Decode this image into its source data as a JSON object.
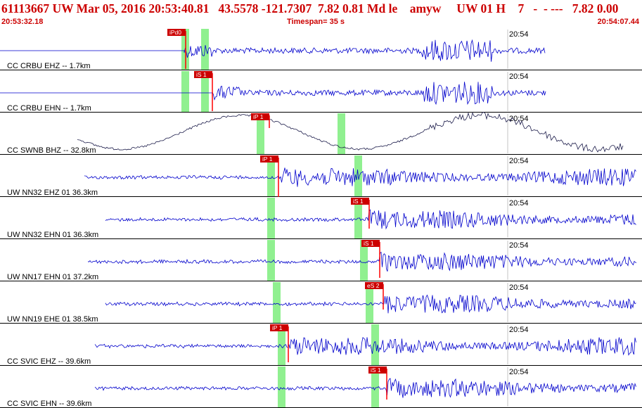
{
  "header": {
    "title": "61113667 UW Mar 05, 2016 20:53:40.81   43.5578 -121.7307  7.82 0.81 Md le    amyw     UW 01 H    7   -  - ---   7.82 0.00",
    "start_time": "20:53:32.18",
    "timespan": "Timespan=  35 s",
    "end_time": "20:54:07.44"
  },
  "time_marker_label": "20:54",
  "colors": {
    "header_text": "#cc0000",
    "trace_blue": "#0000cc",
    "trace_dark": "#1c1c4a",
    "pick_bar": "#ff0000",
    "window_band": "#90f090",
    "separator": "#000000"
  },
  "channels": [
    {
      "label": "CC CRBU EHZ -- 1.7km",
      "style": "blue",
      "pick": "iPd0",
      "amp": 1.0
    },
    {
      "label": "CC CRBU EHN -- 1.7km",
      "style": "blue",
      "pick": "iS 1",
      "amp": 0.9
    },
    {
      "label": "CC SWNB BHZ -- 32.8km",
      "style": "dark",
      "pick": "iP 1",
      "amp": 1.0
    },
    {
      "label": "UW NN32 EHZ 01 36.3km",
      "style": "blue",
      "pick": "iP 1",
      "amp": 1.0
    },
    {
      "label": "UW NN32 EHN 01 36.3km",
      "style": "blue",
      "pick": "iS 1",
      "amp": 1.0
    },
    {
      "label": "UW NN17 EHN 01 37.2km",
      "style": "blue",
      "pick": "iS 1",
      "amp": 1.0
    },
    {
      "label": "UW NN19 EHE 01 38.5km",
      "style": "blue",
      "pick": "eS 2",
      "amp": 1.0
    },
    {
      "label": "CC SVIC EHZ -- 39.6km",
      "style": "blue",
      "pick": "iP 1",
      "amp": 1.0
    },
    {
      "label": "CC SVIC EHN -- 39.6km",
      "style": "blue",
      "pick": "iS 1",
      "amp": 1.0
    }
  ]
}
